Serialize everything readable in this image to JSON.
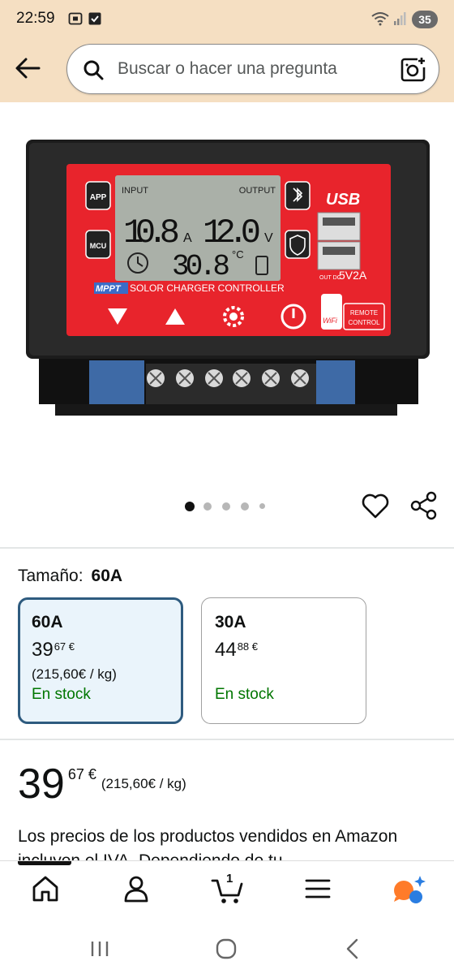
{
  "status_bar": {
    "time": "22:59",
    "battery": "35"
  },
  "search": {
    "placeholder": "Buscar o hacer una pregunta"
  },
  "product_image": {
    "lcd_input": "INPUT",
    "lcd_output": "OUTPUT",
    "lcd_voltage_in": "10.8",
    "lcd_unit_a": "A",
    "lcd_voltage_out": "12.0",
    "lcd_unit_v": "V",
    "lcd_temp": "30.8",
    "lcd_unit_c": "°C",
    "app_label": "APP",
    "mcu_label": "MCU",
    "usb_label": "USB",
    "usb_rating_prefix": "OUT DC",
    "usb_rating": "5V2A",
    "mppt_label": "MPPT",
    "controller_label": "SOLOR CHARGER CONTROLLER",
    "remote_label_1": "REMOTE",
    "remote_label_2": "CONTROL",
    "wifi_label": "WiFi"
  },
  "carousel": {
    "dot_count": 5,
    "active_index": 0
  },
  "size_selector": {
    "label": "Tamaño:",
    "selected": "60A",
    "options": [
      {
        "title": "60A",
        "price_whole": "39",
        "price_frac": "67 €",
        "unit_price": "(215,60€ / kg)",
        "stock": "En stock",
        "selected": true
      },
      {
        "title": "30A",
        "price_whole": "44",
        "price_frac": "88 €",
        "unit_price": "",
        "stock": "En stock",
        "selected": false
      }
    ]
  },
  "price": {
    "whole": "39",
    "frac": "67 €",
    "unit": "(215,60€ / kg)"
  },
  "vat_text": "Los precios de los productos vendidos en Amazon incluyen el IVA. Dependiendo de tu",
  "bottom_nav": {
    "cart_count": "1"
  },
  "colors": {
    "header_bg": "#f5dfc2",
    "selected_border": "#2e5b7f",
    "selected_bg": "#eaf4fb",
    "stock_green": "#007600",
    "controller_red": "#e8242c"
  }
}
